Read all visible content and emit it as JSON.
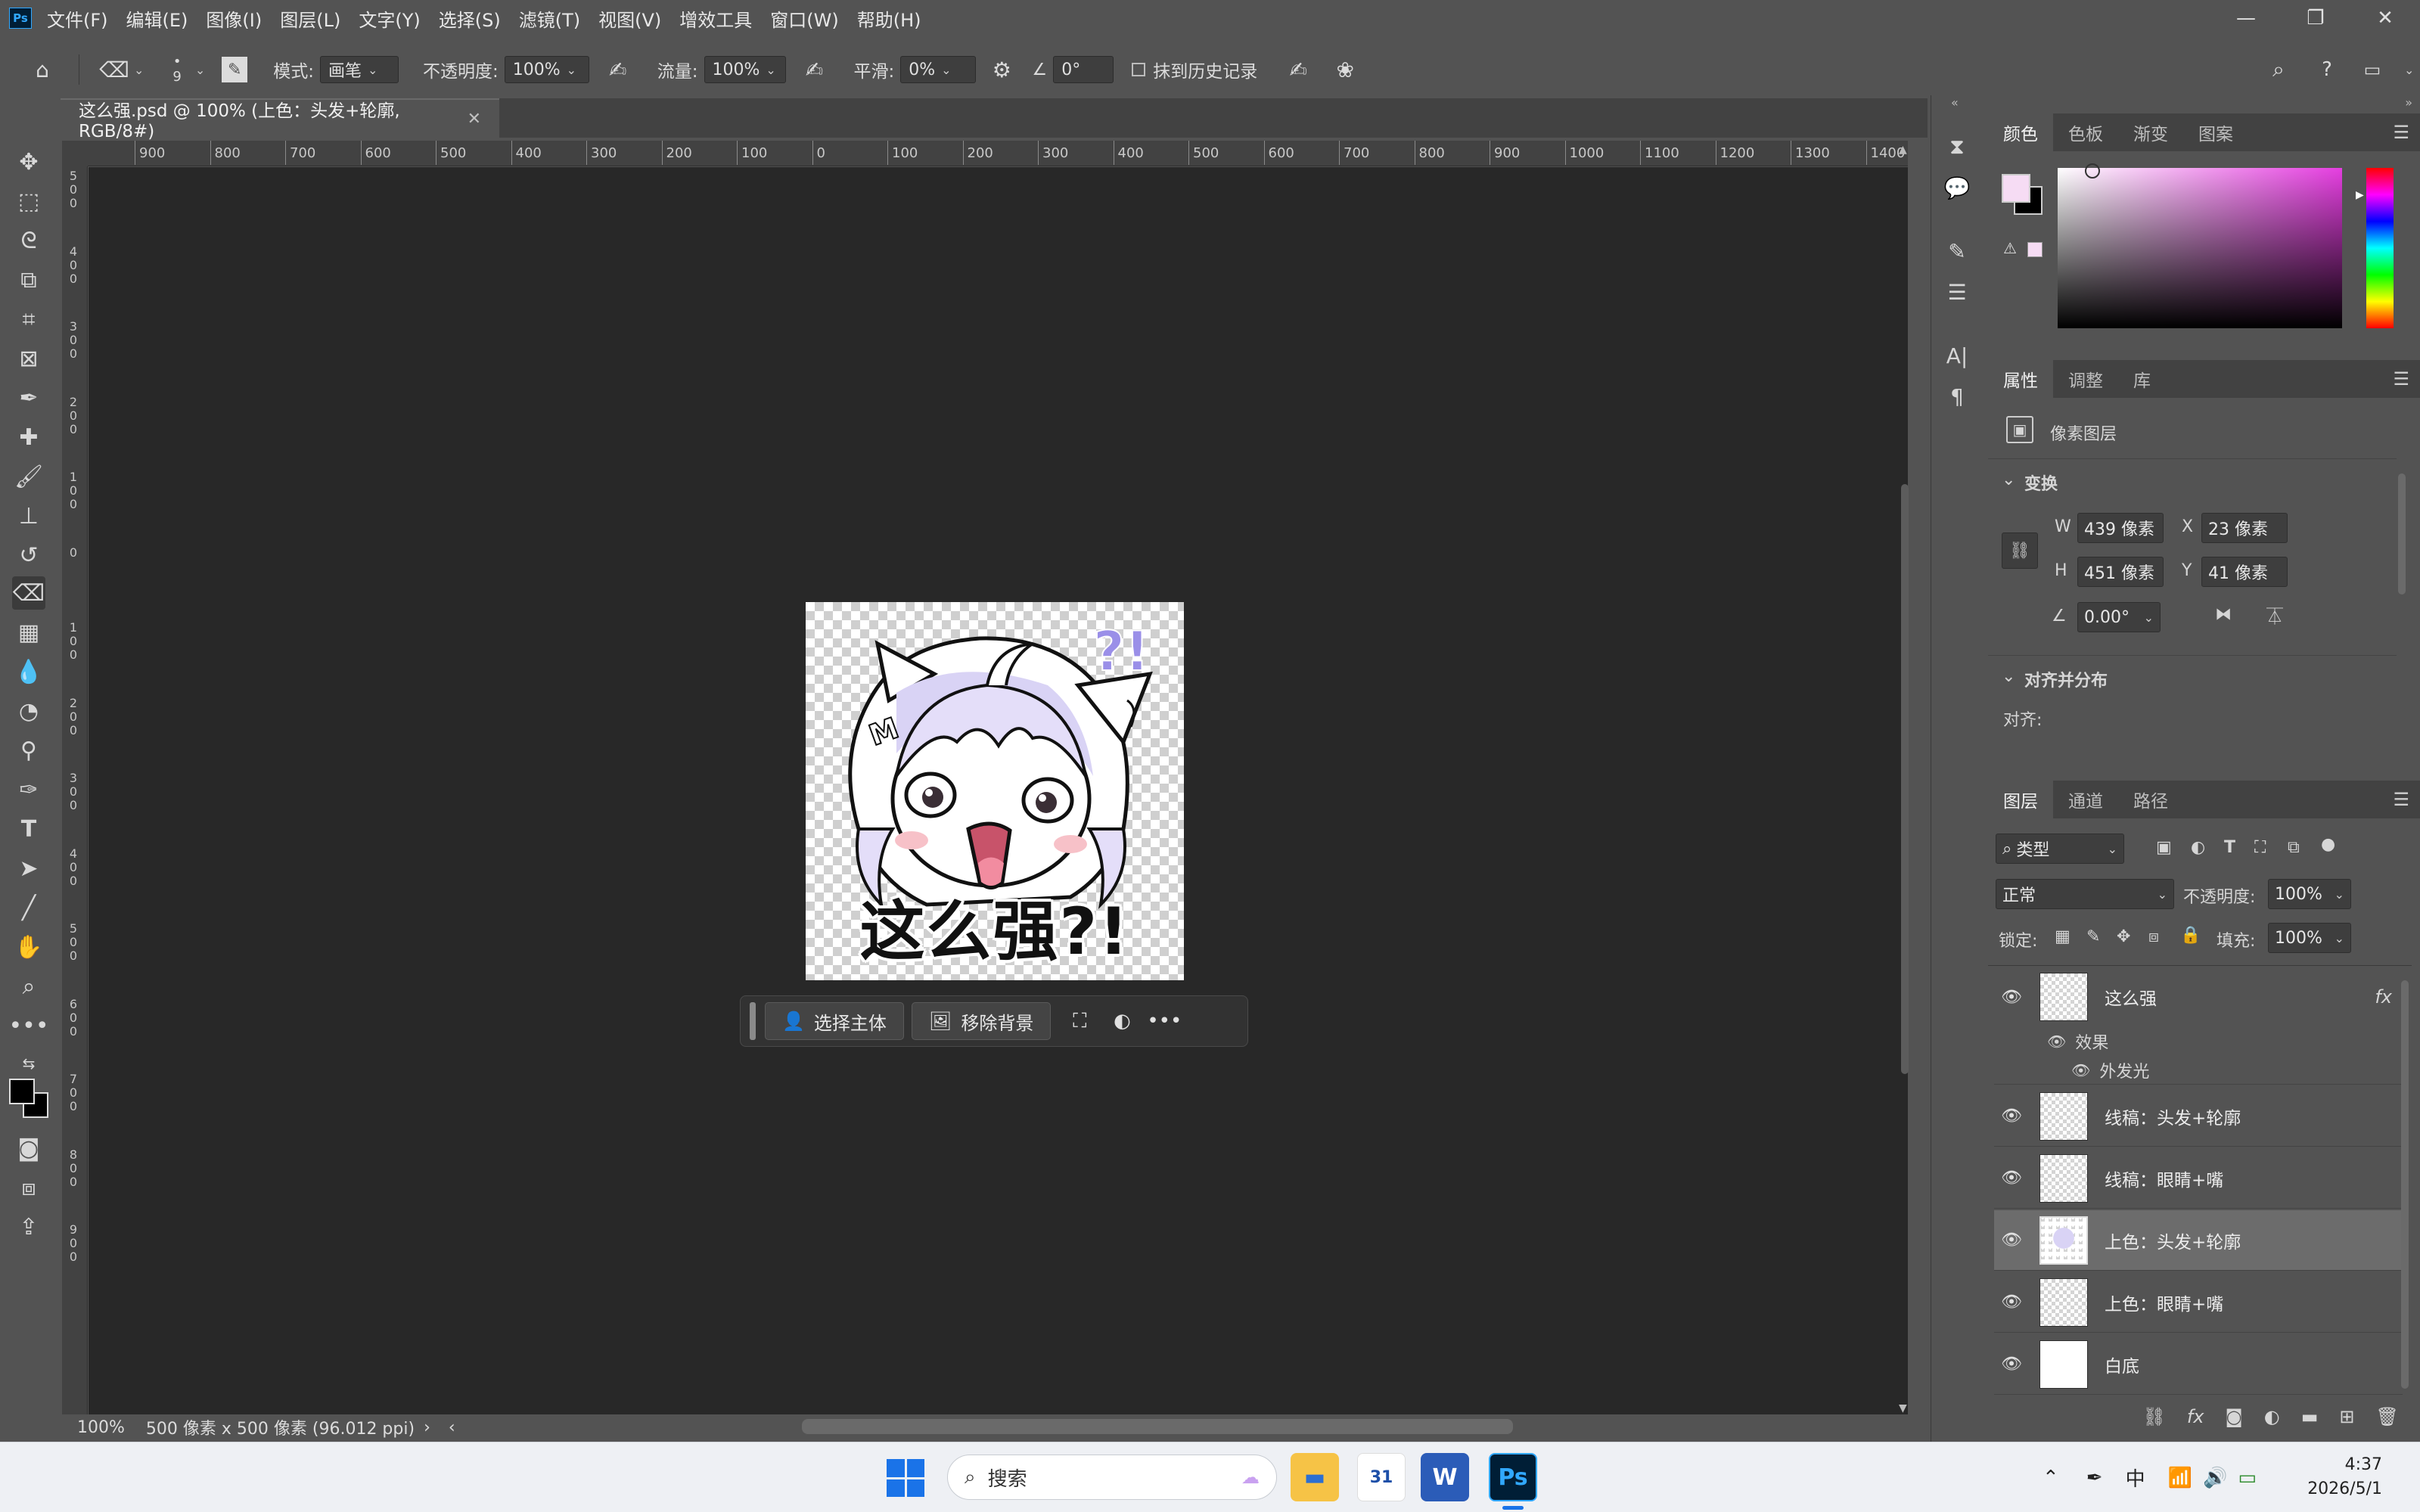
{
  "menubar": {
    "app_badge": "Ps",
    "items": [
      "文件(F)",
      "编辑(E)",
      "图像(I)",
      "图层(L)",
      "文字(Y)",
      "选择(S)",
      "滤镜(T)",
      "视图(V)",
      "增效工具",
      "窗口(W)",
      "帮助(H)"
    ]
  },
  "options": {
    "brush_size": "9",
    "mode_label": "模式:",
    "mode_value": "画笔",
    "opacity_label": "不透明度:",
    "opacity_value": "100%",
    "flow_label": "流量:",
    "flow_value": "100%",
    "smooth_label": "平滑:",
    "smooth_value": "0%",
    "angle_value": "0°",
    "history_label": "抹到历史记录"
  },
  "document": {
    "tab_title": "这么强.psd @ 100% (上色：头发+轮廓, RGB/8#)",
    "art_caption": "这么强?!",
    "zoom": "100%",
    "status_info": "500 像素 x 500 像素 (96.012 ppi)"
  },
  "ruler": {
    "top_ticks": [
      "900",
      "800",
      "700",
      "600",
      "500",
      "400",
      "300",
      "200",
      "100",
      "0",
      "100",
      "200",
      "300",
      "400",
      "500",
      "600",
      "700",
      "800",
      "900",
      "1000",
      "1100",
      "1200",
      "1300",
      "1400"
    ],
    "left_ticks": [
      "500",
      "400",
      "300",
      "200",
      "100",
      "0",
      "100",
      "200",
      "300",
      "400",
      "500",
      "600",
      "700",
      "800",
      "900"
    ]
  },
  "context_bar": {
    "select_subject": "选择主体",
    "remove_background": "移除背景"
  },
  "color_panel": {
    "tabs": [
      "颜色",
      "色板",
      "渐变",
      "图案"
    ],
    "foreground": "#f6dcf4",
    "background": "#000000"
  },
  "properties_panel": {
    "tabs": [
      "属性",
      "调整",
      "库"
    ],
    "layer_type": "像素图层",
    "transform_title": "变换",
    "w_label": "W",
    "w_value": "439 像素",
    "h_label": "H",
    "h_value": "451 像素",
    "x_label": "X",
    "x_value": "23 像素",
    "y_label": "Y",
    "y_value": "41 像素",
    "rotation": "0.00°",
    "align_title": "对齐并分布",
    "align_label": "对齐:"
  },
  "layers_panel": {
    "tabs": [
      "图层",
      "通道",
      "路径"
    ],
    "filter_value": "类型",
    "blend_mode": "正常",
    "opacity_label": "不透明度:",
    "opacity_value": "100%",
    "lock_label": "锁定:",
    "fill_label": "填充:",
    "fill_value": "100%",
    "fx_badge": "fx",
    "effects_label": "效果",
    "outer_glow_label": "外发光",
    "layers": [
      {
        "name": "这么强"
      },
      {
        "name": "线稿：头发+轮廓"
      },
      {
        "name": "线稿：眼睛+嘴"
      },
      {
        "name": "上色：头发+轮廓"
      },
      {
        "name": "上色：眼睛+嘴"
      },
      {
        "name": "白底"
      }
    ]
  },
  "taskbar": {
    "search_placeholder": "搜索",
    "ime": "中",
    "time": "4:37",
    "date": "2026/5/1"
  }
}
